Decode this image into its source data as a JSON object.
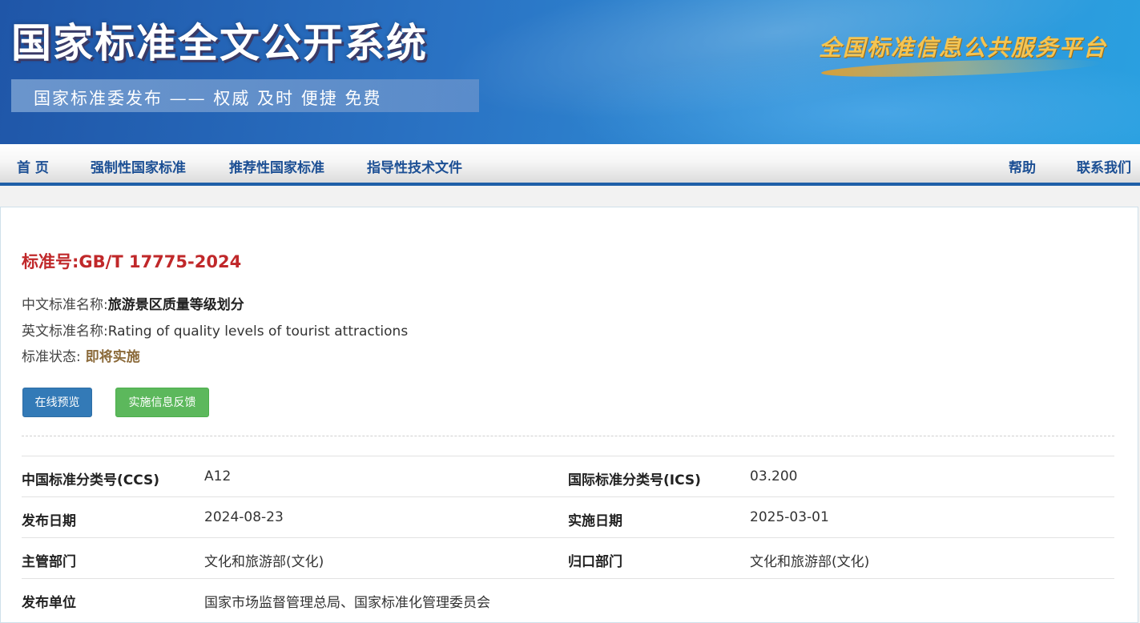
{
  "header": {
    "site_title": "国家标准全文公开系统",
    "slogan": "国家标准委发布 —— 权威 及时 便捷 免费",
    "brand": "全国标准信息公共服务平台"
  },
  "nav": {
    "home": "首 页",
    "mandatory": "强制性国家标准",
    "recommended": "推荐性国家标准",
    "guidance": "指导性技术文件",
    "help": "帮助",
    "contact": "联系我们"
  },
  "standard": {
    "number_label": "标准号:",
    "number": "GB/T 17775-2024",
    "cn_name_label": "中文标准名称:",
    "cn_name": "旅游景区质量等级划分",
    "en_name_label": "英文标准名称:",
    "en_name": "Rating of quality levels of tourist attractions",
    "status_label": "标准状态:",
    "status": "即将实施"
  },
  "buttons": {
    "preview": "在线预览",
    "feedback": "实施信息反馈"
  },
  "details": [
    {
      "k1": "中国标准分类号(CCS)",
      "v1": "A12",
      "k2": "国际标准分类号(ICS)",
      "v2": "03.200"
    },
    {
      "k1": "发布日期",
      "v1": "2024-08-23",
      "k2": "实施日期",
      "v2": "2025-03-01"
    },
    {
      "k1": "主管部门",
      "v1": "文化和旅游部(文化)",
      "k2": "归口部门",
      "v2": "文化和旅游部(文化)"
    },
    {
      "k1": "发布单位",
      "v1": "国家市场监督管理总局、国家标准化管理委员会",
      "k2": "",
      "v2": ""
    }
  ],
  "colors": {
    "nav_text": "#1c4f94",
    "standard_number": "#c0282a",
    "status": "#8b6a3a",
    "btn_primary": "#337ab7",
    "btn_success": "#5cb85c"
  }
}
